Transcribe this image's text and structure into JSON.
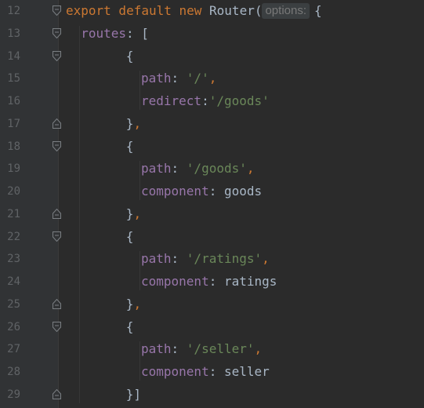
{
  "editor": {
    "lines": [
      {
        "num": "12",
        "fold": "open",
        "indent": 0,
        "tokens": [
          {
            "cls": "kw",
            "text": "export default new "
          },
          {
            "cls": "id",
            "text": "Router("
          },
          {
            "cls": "hint",
            "text": "options:"
          },
          {
            "cls": "id",
            "text": "{"
          }
        ]
      },
      {
        "num": "13",
        "fold": "open",
        "indent": 2,
        "tokens": [
          {
            "cls": "prop",
            "text": "routes"
          },
          {
            "cls": "id",
            "text": ": ["
          }
        ]
      },
      {
        "num": "14",
        "fold": "open",
        "indent": 8,
        "tokens": [
          {
            "cls": "id",
            "text": "{"
          }
        ]
      },
      {
        "num": "15",
        "fold": "none",
        "indent": 10,
        "tokens": [
          {
            "cls": "prop",
            "text": "path"
          },
          {
            "cls": "id",
            "text": ": "
          },
          {
            "cls": "str",
            "text": "'/'"
          },
          {
            "cls": "kw",
            "text": ","
          }
        ]
      },
      {
        "num": "16",
        "fold": "none",
        "indent": 10,
        "tokens": [
          {
            "cls": "prop",
            "text": "redirect"
          },
          {
            "cls": "id",
            "text": ":"
          },
          {
            "cls": "str",
            "text": "'/goods'"
          }
        ]
      },
      {
        "num": "17",
        "fold": "close",
        "indent": 8,
        "tokens": [
          {
            "cls": "id",
            "text": "}"
          },
          {
            "cls": "kw",
            "text": ","
          }
        ]
      },
      {
        "num": "18",
        "fold": "open",
        "indent": 8,
        "tokens": [
          {
            "cls": "id",
            "text": "{"
          }
        ]
      },
      {
        "num": "19",
        "fold": "none",
        "indent": 10,
        "tokens": [
          {
            "cls": "prop",
            "text": "path"
          },
          {
            "cls": "id",
            "text": ": "
          },
          {
            "cls": "str",
            "text": "'/goods'"
          },
          {
            "cls": "kw",
            "text": ","
          }
        ]
      },
      {
        "num": "20",
        "fold": "none",
        "indent": 10,
        "tokens": [
          {
            "cls": "prop",
            "text": "component"
          },
          {
            "cls": "id",
            "text": ": goods"
          }
        ]
      },
      {
        "num": "21",
        "fold": "close",
        "indent": 8,
        "tokens": [
          {
            "cls": "id",
            "text": "}"
          },
          {
            "cls": "kw",
            "text": ","
          }
        ]
      },
      {
        "num": "22",
        "fold": "open",
        "indent": 8,
        "tokens": [
          {
            "cls": "id",
            "text": "{"
          }
        ]
      },
      {
        "num": "23",
        "fold": "none",
        "indent": 10,
        "tokens": [
          {
            "cls": "prop",
            "text": "path"
          },
          {
            "cls": "id",
            "text": ": "
          },
          {
            "cls": "str",
            "text": "'/ratings'"
          },
          {
            "cls": "kw",
            "text": ","
          }
        ]
      },
      {
        "num": "24",
        "fold": "none",
        "indent": 10,
        "tokens": [
          {
            "cls": "prop",
            "text": "component"
          },
          {
            "cls": "id",
            "text": ": ratings"
          }
        ]
      },
      {
        "num": "25",
        "fold": "close",
        "indent": 8,
        "tokens": [
          {
            "cls": "id",
            "text": "}"
          },
          {
            "cls": "kw",
            "text": ","
          }
        ]
      },
      {
        "num": "26",
        "fold": "open",
        "indent": 8,
        "tokens": [
          {
            "cls": "id",
            "text": "{"
          }
        ]
      },
      {
        "num": "27",
        "fold": "none",
        "indent": 10,
        "tokens": [
          {
            "cls": "prop",
            "text": "path"
          },
          {
            "cls": "id",
            "text": ": "
          },
          {
            "cls": "str",
            "text": "'/seller'"
          },
          {
            "cls": "kw",
            "text": ","
          }
        ]
      },
      {
        "num": "28",
        "fold": "none",
        "indent": 10,
        "tokens": [
          {
            "cls": "prop",
            "text": "component"
          },
          {
            "cls": "id",
            "text": ": seller"
          }
        ]
      },
      {
        "num": "29",
        "fold": "close",
        "indent": 8,
        "tokens": [
          {
            "cls": "id",
            "text": "}]"
          }
        ]
      }
    ]
  },
  "colors": {
    "background": "#2b2b2b",
    "gutter": "#313335",
    "line_number": "#606366",
    "keyword": "#cc7832",
    "identifier": "#a9b7c6",
    "property": "#9876aa",
    "string": "#6a8759",
    "hint_bg": "#3b3f41",
    "hint_text": "#787878"
  }
}
